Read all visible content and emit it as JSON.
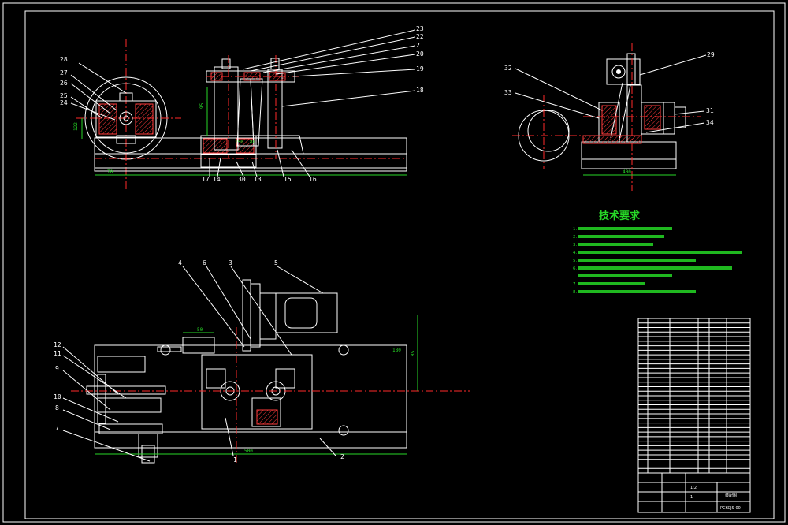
{
  "tech_requirements": {
    "title": "技术要求",
    "items": [
      "1.",
      "2.",
      "3.",
      "4.",
      "5.",
      "6.",
      "7.",
      "8."
    ]
  },
  "title_block": {
    "drawing_number": "PCKCJS-00",
    "name": "装配图",
    "scale": "1:2",
    "sheet": "1"
  },
  "callouts": {
    "front": [
      "28",
      "27",
      "26",
      "25",
      "24",
      "23",
      "22",
      "21",
      "20",
      "19",
      "18",
      "17",
      "14",
      "13",
      "15",
      "16",
      "30"
    ],
    "side": [
      "29",
      "32",
      "33",
      "31",
      "34"
    ],
    "plan": [
      "4",
      "6",
      "3",
      "5",
      "12",
      "11",
      "9",
      "10",
      "8",
      "7",
      "1",
      "2"
    ]
  },
  "colors": {
    "background": "#000000",
    "outline": "#ffffff",
    "dimension": "#27d927",
    "center": "#ff2a2a",
    "note": "#27d927"
  }
}
